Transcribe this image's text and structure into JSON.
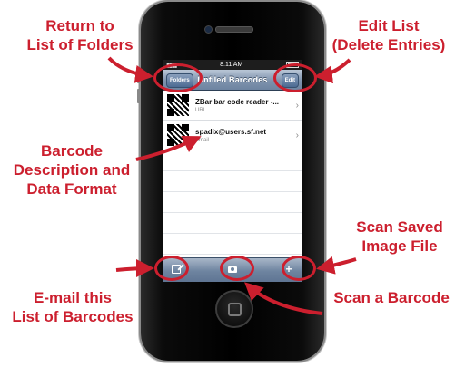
{
  "annotations": {
    "return_folders": [
      "Return to",
      "List of Folders"
    ],
    "edit_list": [
      "Edit List",
      "(Delete Entries)"
    ],
    "barcode_desc": [
      "Barcode",
      "Description and",
      "Data Format"
    ],
    "scan_saved": [
      "Scan Saved",
      "Image File"
    ],
    "email_list": [
      "E-mail this",
      "List of Barcodes"
    ],
    "scan_barcode": [
      "Scan a Barcode"
    ]
  },
  "status_bar": {
    "time": "8:11 AM"
  },
  "navbar": {
    "title": "Unfiled Barcodes",
    "left_button": "Folders",
    "right_button": "Edit"
  },
  "rows": [
    {
      "title": "ZBar bar code reader -...",
      "subtitle": "URL"
    },
    {
      "title": "spadix@users.sf.net",
      "subtitle": "Email"
    }
  ],
  "toolbar": {
    "add_label": "+"
  },
  "colors": {
    "annotation_red": "#cc1f2e",
    "navbar_blue": "#7f93ad"
  },
  "icons": [
    "compose-icon",
    "camera-icon",
    "plus-icon",
    "chevron-right-icon",
    "battery-icon",
    "qr-code-icon"
  ]
}
